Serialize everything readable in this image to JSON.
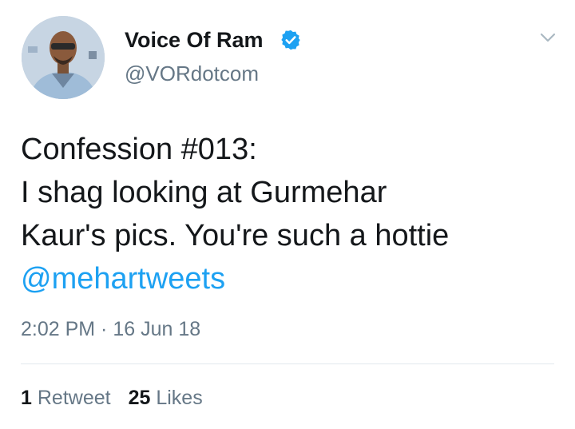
{
  "user": {
    "display_name": "Voice Of Ram",
    "handle": "@VORdotcom",
    "verified_icon": "verified-badge-icon",
    "avatar": "profile-avatar"
  },
  "tweet": {
    "lines": [
      "Confession #013:",
      "I shag looking at Gurmehar",
      "Kaur's pics. You're such a hottie"
    ],
    "mention": "@mehartweets",
    "time": "2:02 PM",
    "separator": " · ",
    "date": "16 Jun 18"
  },
  "stats": {
    "retweets_count": "1",
    "retweets_label": "Retweet",
    "likes_count": "25",
    "likes_label": "Likes"
  },
  "menu": {
    "icon": "chevron-down-icon"
  },
  "colors": {
    "link": "#1da1f2",
    "text": "#14171a",
    "secondary": "#657786",
    "divider": "#e1e8ed",
    "verified": "#1da1f2"
  }
}
